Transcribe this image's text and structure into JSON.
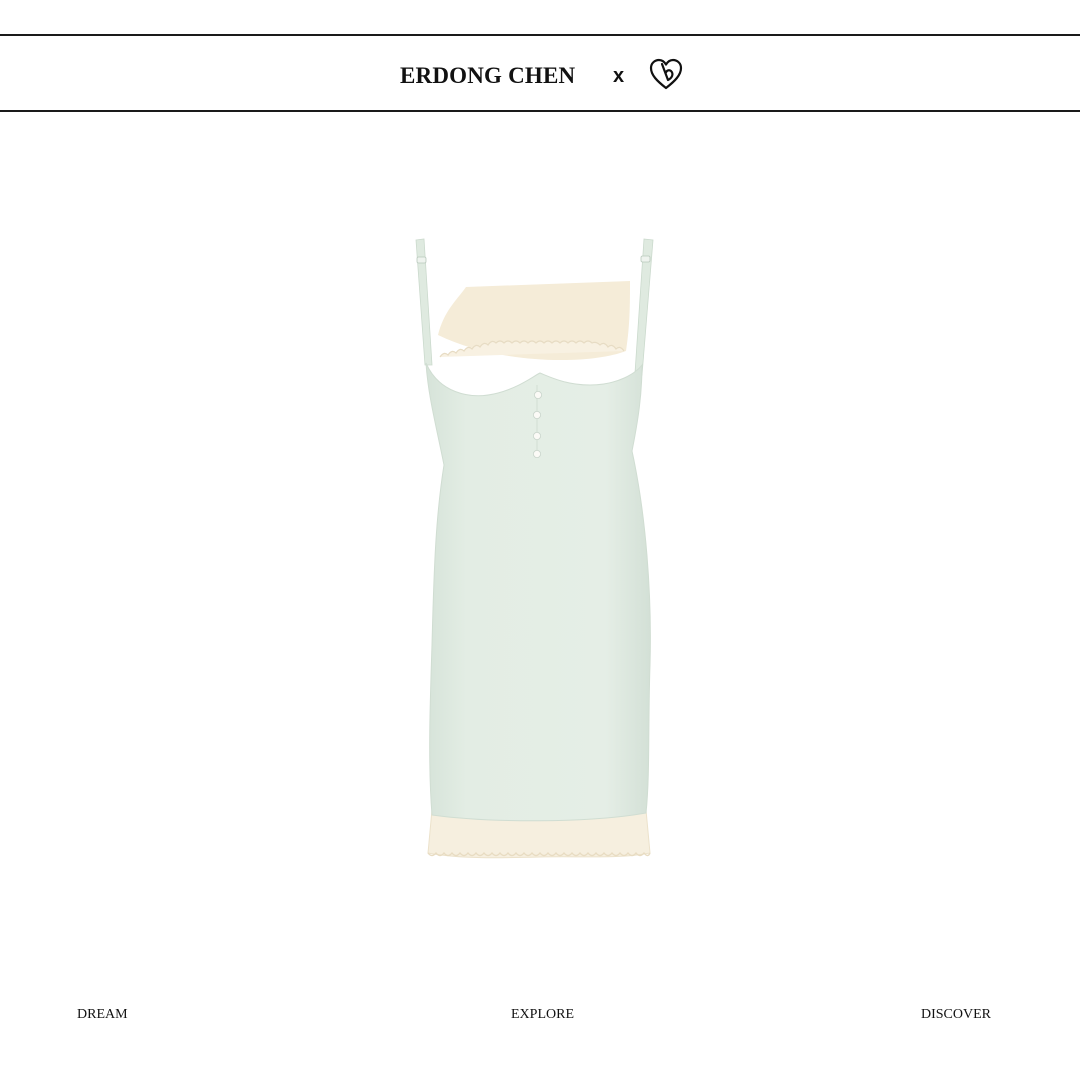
{
  "header": {
    "brand": "ERDONG CHEN",
    "separator": "x",
    "partner_logo_icon": "heart-monogram-icon"
  },
  "product": {
    "image_icon": "slip-dress-image",
    "colors": {
      "dress": "#e3ede4",
      "lining": "#f6efdf",
      "buttons": "#fbfaf6"
    }
  },
  "footer": {
    "nav": [
      "DREAM",
      "EXPLORE",
      "DISCOVER"
    ]
  }
}
